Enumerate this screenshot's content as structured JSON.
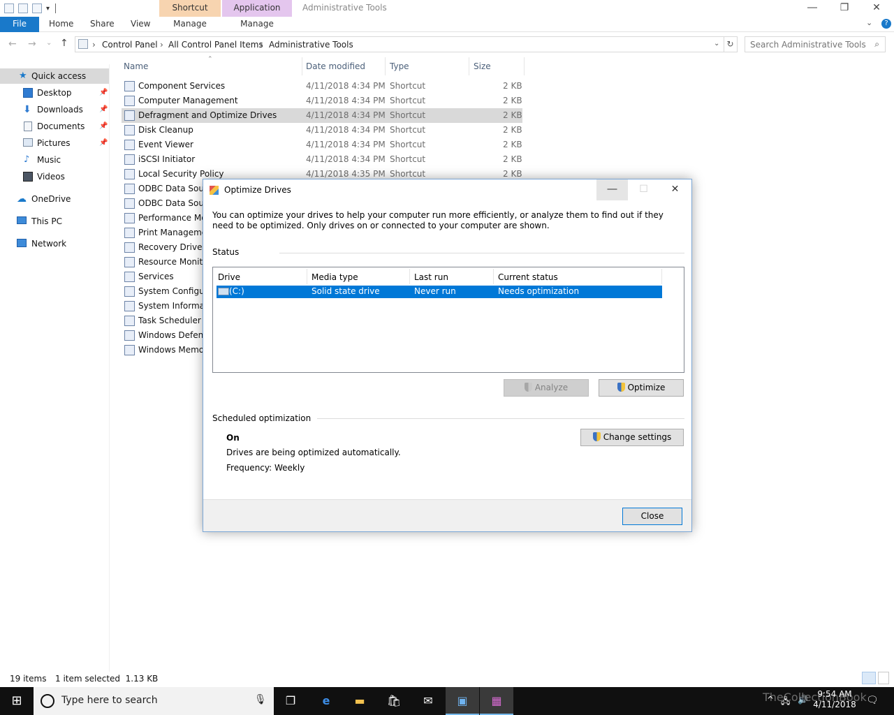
{
  "explorer": {
    "title": "Administrative Tools",
    "context_tabs": [
      {
        "group": "Shortcut Tools",
        "tab": "Manage"
      },
      {
        "group": "Application Tools",
        "tab": "Manage"
      }
    ],
    "ribbon_tabs": [
      "File",
      "Home",
      "Share",
      "View"
    ],
    "breadcrumb": [
      "Control Panel",
      "All Control Panel Items",
      "Administrative Tools"
    ],
    "search_placeholder": "Search Administrative Tools",
    "nav": {
      "quick_access": "Quick access",
      "items": [
        "Desktop",
        "Downloads",
        "Documents",
        "Pictures",
        "Music",
        "Videos"
      ],
      "onedrive": "OneDrive",
      "this_pc": "This PC",
      "network": "Network"
    },
    "columns": [
      "Name",
      "Date modified",
      "Type",
      "Size"
    ],
    "files": [
      {
        "name": "Component Services",
        "date": "4/11/2018 4:34 PM",
        "type": "Shortcut",
        "size": "2 KB"
      },
      {
        "name": "Computer Management",
        "date": "4/11/2018 4:34 PM",
        "type": "Shortcut",
        "size": "2 KB"
      },
      {
        "name": "Defragment and Optimize Drives",
        "date": "4/11/2018 4:34 PM",
        "type": "Shortcut",
        "size": "2 KB"
      },
      {
        "name": "Disk Cleanup",
        "date": "4/11/2018 4:34 PM",
        "type": "Shortcut",
        "size": "2 KB"
      },
      {
        "name": "Event Viewer",
        "date": "4/11/2018 4:34 PM",
        "type": "Shortcut",
        "size": "2 KB"
      },
      {
        "name": "iSCSI Initiator",
        "date": "4/11/2018 4:34 PM",
        "type": "Shortcut",
        "size": "2 KB"
      },
      {
        "name": "Local Security Policy",
        "date": "4/11/2018 4:35 PM",
        "type": "Shortcut",
        "size": "2 KB"
      },
      {
        "name": "ODBC Data Sourc",
        "date": "",
        "type": "",
        "size": ""
      },
      {
        "name": "ODBC Data Sourc",
        "date": "",
        "type": "",
        "size": ""
      },
      {
        "name": "Performance Mor",
        "date": "",
        "type": "",
        "size": ""
      },
      {
        "name": "Print Managemer",
        "date": "",
        "type": "",
        "size": ""
      },
      {
        "name": "Recovery Drive",
        "date": "",
        "type": "",
        "size": ""
      },
      {
        "name": "Resource Monito",
        "date": "",
        "type": "",
        "size": ""
      },
      {
        "name": "Services",
        "date": "",
        "type": "",
        "size": ""
      },
      {
        "name": "System Configura",
        "date": "",
        "type": "",
        "size": ""
      },
      {
        "name": "System Informati",
        "date": "",
        "type": "",
        "size": ""
      },
      {
        "name": "Task Scheduler",
        "date": "",
        "type": "",
        "size": ""
      },
      {
        "name": "Windows Defende",
        "date": "",
        "type": "",
        "size": ""
      },
      {
        "name": "Windows Memor",
        "date": "",
        "type": "",
        "size": ""
      }
    ],
    "selected_file_index": 2,
    "status_count": "19 items",
    "status_selected": "1 item selected  1.13 KB"
  },
  "dialog": {
    "title": "Optimize Drives",
    "intro": "You can optimize your drives to help your computer run more efficiently, or analyze them to find out if they need to be optimized. Only drives on or connected to your computer are shown.",
    "status_label": "Status",
    "columns": [
      "Drive",
      "Media type",
      "Last run",
      "Current status"
    ],
    "drive": {
      "name": "(C:)",
      "media_type": "Solid state drive",
      "last_run": "Never run",
      "status": "Needs optimization"
    },
    "analyze_label": "Analyze",
    "optimize_label": "Optimize",
    "scheduled_label": "Scheduled optimization",
    "sched_state": "On",
    "sched_desc": "Drives are being optimized automatically.",
    "sched_freq": "Frequency: Weekly",
    "change_settings_label": "Change settings",
    "close_label": "Close"
  },
  "taskbar": {
    "search_placeholder": "Type here to search",
    "time": "9:54 AM",
    "date": "4/11/2018",
    "watermark": "TheCollectionBook"
  },
  "colors": {
    "accent": "#0078d7",
    "file_tab": "#1979ca",
    "shortcut_tools": "#f7d4b0",
    "application_tools": "#e4c6ee"
  }
}
